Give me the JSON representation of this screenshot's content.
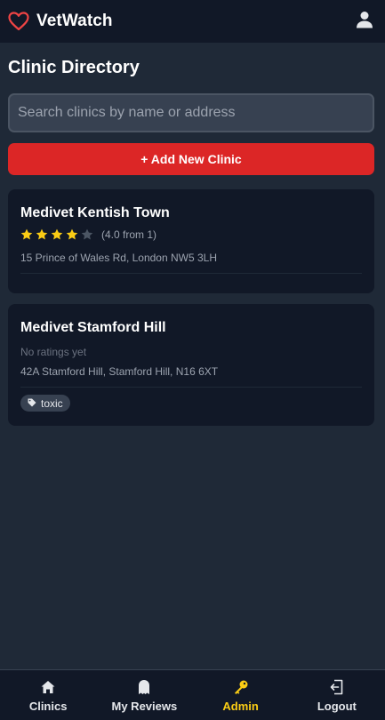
{
  "header": {
    "app_name": "VetWatch",
    "brand_icon": "heart-outline-icon",
    "profile_icon": "user-icon"
  },
  "page": {
    "title": "Clinic Directory"
  },
  "search": {
    "placeholder": "Search clinics by name or address",
    "value": ""
  },
  "add_button": {
    "label": "+ Add New Clinic"
  },
  "clinics": [
    {
      "name": "Medivet Kentish Town",
      "rating": 4,
      "rating_text": "(4.0 from 1)",
      "address": "15 Prince of Wales Rd, London NW5 3LH",
      "tags": []
    },
    {
      "name": "Medivet Stamford Hill",
      "no_ratings_text": "No ratings yet",
      "address": "42A Stamford Hill, Stamford Hill, N16 6XT",
      "tags": [
        "toxic"
      ]
    }
  ],
  "nav": {
    "items": [
      {
        "label": "Clinics",
        "icon": "home-icon"
      },
      {
        "label": "My Reviews",
        "icon": "ghost-icon"
      },
      {
        "label": "Admin",
        "icon": "key-icon",
        "active": true
      },
      {
        "label": "Logout",
        "icon": "logout-icon"
      }
    ]
  },
  "colors": {
    "accent_red": "#dc2626",
    "star_filled": "#facc15",
    "star_empty": "#4b5563",
    "active_nav": "#facc15"
  }
}
